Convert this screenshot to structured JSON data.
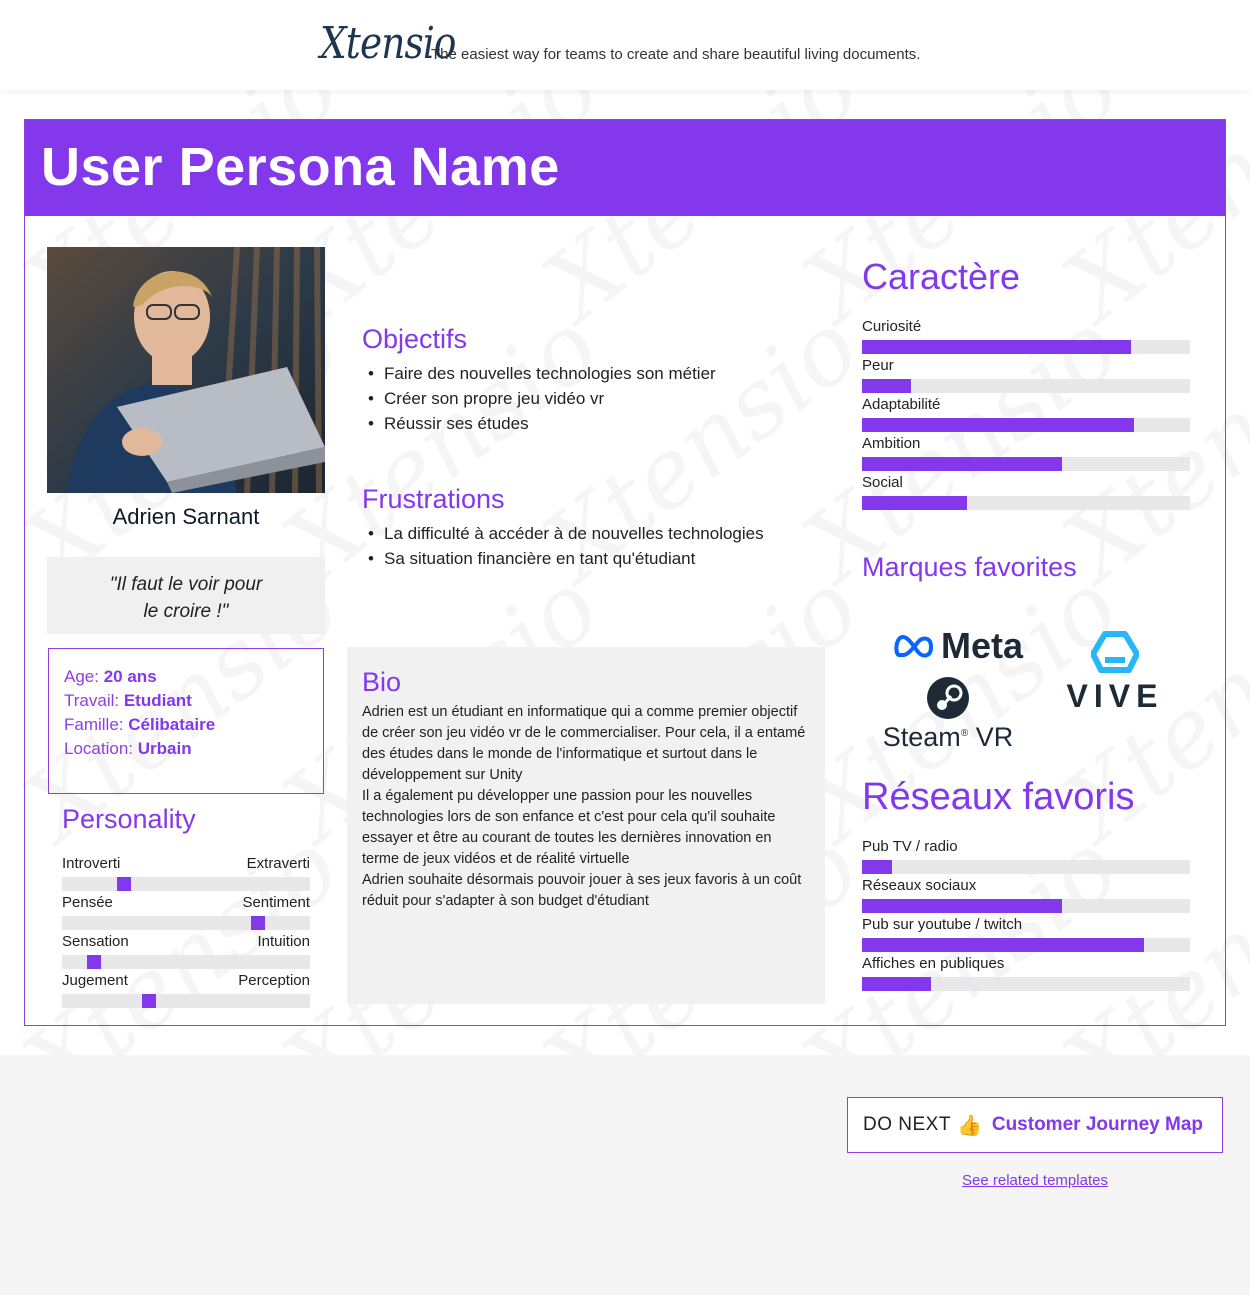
{
  "header": {
    "logo": "Xtensio",
    "tagline": "The easiest way for teams to create and share beautiful living documents."
  },
  "persona": {
    "title": "User Persona Name",
    "name": "Adrien Sarnant",
    "quote_line1": "\"Il faut le voir pour",
    "quote_line2": "le croire !\"",
    "info": [
      {
        "label": "Age:",
        "value": "20 ans"
      },
      {
        "label": "Travail:",
        "value": "Etudiant"
      },
      {
        "label": "Famille:",
        "value": "Célibataire"
      },
      {
        "label": "Location:",
        "value": "Urbain"
      }
    ]
  },
  "personality": {
    "title": "Personality",
    "scales": [
      {
        "left": "Introverti",
        "right": "Extraverti",
        "value": 0.25
      },
      {
        "left": "Pensée",
        "right": "Sentiment",
        "value": 0.79
      },
      {
        "left": "Sensation",
        "right": "Intuition",
        "value": 0.13
      },
      {
        "left": "Jugement",
        "right": "Perception",
        "value": 0.35
      }
    ]
  },
  "objectifs": {
    "title": "Objectifs",
    "items": [
      "Faire des nouvelles technologies son métier",
      "Créer son propre jeu vidéo vr",
      "Réussir ses études"
    ]
  },
  "frustrations": {
    "title": "Frustrations",
    "items": [
      "La difficulté à accéder à de nouvelles technologies",
      "Sa situation financière en tant qu'étudiant"
    ]
  },
  "bio": {
    "title": "Bio",
    "paragraphs": [
      "Adrien est un étudiant en informatique qui a comme premier objectif de créer son jeu vidéo vr de le commercialiser. Pour cela, il a entamé des études dans le monde de l'informatique et surtout dans le développement sur Unity",
      "Il a également pu développer une passion pour les nouvelles technologies lors de son enfance et c'est pour cela qu'il souhaite essayer et être au courant de toutes les dernières innovation en terme de jeux vidéos et de réalité virtuelle",
      "Adrien souhaite désormais pouvoir jouer à ses jeux favoris à un coût réduit pour s'adapter à son budget d'étudiant"
    ]
  },
  "caractere": {
    "title": "Caractère",
    "bars": [
      {
        "label": "Curiosité",
        "value": 0.82
      },
      {
        "label": "Peur",
        "value": 0.15
      },
      {
        "label": "Adaptabilité",
        "value": 0.83
      },
      {
        "label": "Ambition",
        "value": 0.61
      },
      {
        "label": "Social",
        "value": 0.32
      }
    ]
  },
  "marques": {
    "title": "Marques favorites",
    "brands": [
      "Meta",
      "VIVE",
      "Steam",
      "VR"
    ],
    "registered": "®"
  },
  "reseaux": {
    "title": "Réseaux favoris",
    "bars": [
      {
        "label": "Pub TV / radio",
        "value": 0.09
      },
      {
        "label": "Réseaux sociaux",
        "value": 0.61
      },
      {
        "label": "Pub sur youtube / twitch",
        "value": 0.86
      },
      {
        "label": "Affiches en publiques",
        "value": 0.21
      }
    ]
  },
  "footer": {
    "do_next": "DO NEXT",
    "link": "Customer Journey Map",
    "related": "See related templates"
  },
  "colors": {
    "accent": "#8338ec",
    "border": "#8e3fe0",
    "track": "#e8e8ea"
  }
}
